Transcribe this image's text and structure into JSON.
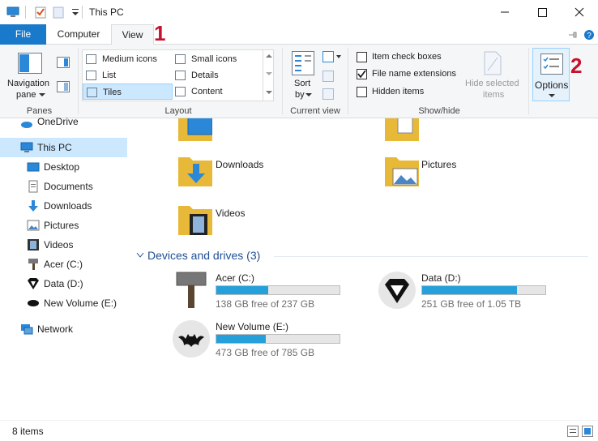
{
  "window": {
    "title": "This PC",
    "minimize_icon": "minimize-icon",
    "maximize_icon": "maximize-icon",
    "close_icon": "close-icon"
  },
  "tabs": {
    "file": "File",
    "computer": "Computer",
    "view": "View"
  },
  "annotations": {
    "one": "1",
    "two": "2"
  },
  "ribbon": {
    "panes": {
      "navigation_pane_line1": "Navigation",
      "navigation_pane_line2": "pane",
      "label": "Panes"
    },
    "layout": {
      "label": "Layout",
      "items": [
        "Medium icons",
        "Small icons",
        "List",
        "Details",
        "Tiles",
        "Content"
      ],
      "selected": "Tiles"
    },
    "current_view": {
      "sort_line1": "Sort",
      "sort_line2": "by",
      "label": "Current view"
    },
    "show_hide": {
      "item_check_boxes": "Item check boxes",
      "file_name_extensions": "File name extensions",
      "hidden_items": "Hidden items",
      "hide_selected_line1": "Hide selected",
      "hide_selected_line2": "items",
      "label": "Show/hide",
      "checked": [
        "File name extensions"
      ]
    },
    "options": "Options"
  },
  "nav": {
    "items": [
      "OneDrive",
      "This PC",
      "Desktop",
      "Documents",
      "Downloads",
      "Pictures",
      "Videos",
      "Acer (C:)",
      "Data (D:)",
      "New Volume (E:)",
      "Network"
    ],
    "selected": "This PC"
  },
  "folders": {
    "downloads": "Downloads",
    "pictures": "Pictures",
    "videos": "Videos"
  },
  "devices": {
    "header": "Devices and drives (3)",
    "drives": [
      {
        "name": "Acer (C:)",
        "free": "138 GB free of 237 GB",
        "used_fraction": 0.42
      },
      {
        "name": "Data (D:)",
        "free": "251 GB free of 1.05 TB",
        "used_fraction": 0.77
      },
      {
        "name": "New Volume (E:)",
        "free": "473 GB free of 785 GB",
        "used_fraction": 0.4
      }
    ]
  },
  "status": {
    "items": "8 items"
  },
  "colors": {
    "accent": "#1979ca",
    "annotation": "#c8102e",
    "drive_bar": "#26a0da",
    "selection": "#cce8ff"
  }
}
